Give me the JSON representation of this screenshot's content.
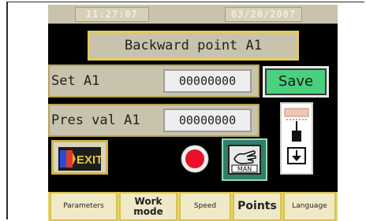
{
  "header": {
    "time": "11:27:07",
    "date": "03/20/2007"
  },
  "title": "Backward point A1",
  "fields": [
    {
      "label": "Set A1",
      "value": "00000000"
    },
    {
      "label": "Pres val A1",
      "value": "00000000"
    }
  ],
  "buttons": {
    "save": "Save",
    "exit": "EXIT",
    "man": "MAN"
  },
  "tabs": [
    {
      "label": "Parameters"
    },
    {
      "label": "Work mode"
    },
    {
      "label": "Speed"
    },
    {
      "label": "Points"
    },
    {
      "label": "Language"
    }
  ],
  "colors": {
    "screen": "#000000",
    "panel": "#c9c3ad",
    "accent": "#e6cc59",
    "save": "#4bd07e",
    "stop": "#e8102a"
  }
}
